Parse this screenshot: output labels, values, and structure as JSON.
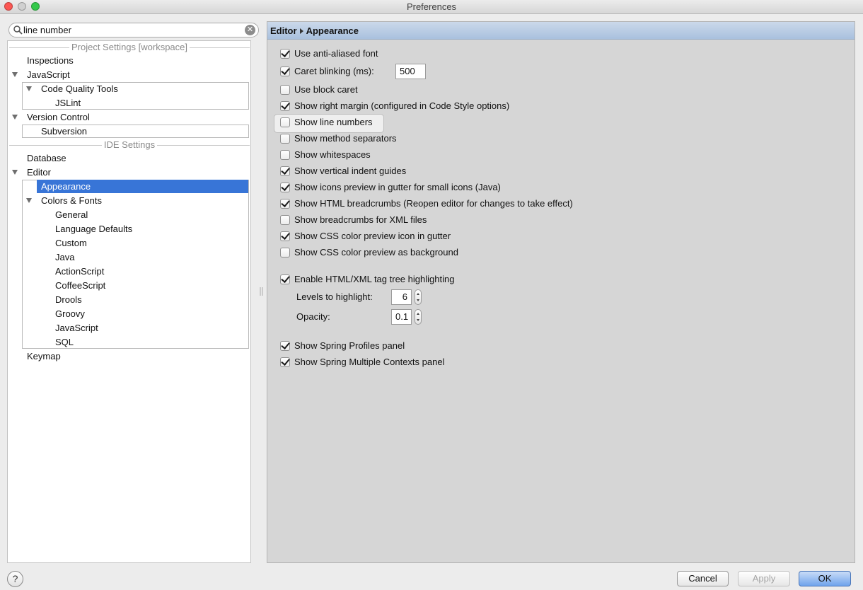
{
  "window": {
    "title": "Preferences"
  },
  "search": {
    "value": "line number"
  },
  "tree": {
    "project_header": "Project Settings [workspace]",
    "ide_header": "IDE Settings",
    "items": {
      "inspections": "Inspections",
      "javascript": "JavaScript",
      "code_quality_tools": "Code Quality Tools",
      "jslint": "JSLint",
      "version_control": "Version Control",
      "subversion": "Subversion",
      "database": "Database",
      "editor": "Editor",
      "appearance": "Appearance",
      "colors_fonts": "Colors & Fonts",
      "general": "General",
      "language_defaults": "Language Defaults",
      "custom": "Custom",
      "java": "Java",
      "actionscript": "ActionScript",
      "coffeescript": "CoffeeScript",
      "drools": "Drools",
      "groovy": "Groovy",
      "javascript2": "JavaScript",
      "sql": "SQL",
      "keymap": "Keymap"
    },
    "selected": "Appearance"
  },
  "panel": {
    "breadcrumb": [
      "Editor",
      "Appearance"
    ],
    "options": {
      "anti_aliased": {
        "label": "Use anti-aliased font",
        "checked": true
      },
      "caret_blinking": {
        "label": "Caret blinking (ms):",
        "checked": true,
        "value": "500"
      },
      "block_caret": {
        "label": "Use block caret",
        "checked": false
      },
      "right_margin": {
        "label": "Show right margin (configured in Code Style options)",
        "checked": true
      },
      "line_numbers": {
        "label": "Show line numbers",
        "checked": false
      },
      "method_separators": {
        "label": "Show method separators",
        "checked": false
      },
      "whitespaces": {
        "label": "Show whitespaces",
        "checked": false
      },
      "indent_guides": {
        "label": "Show vertical indent guides",
        "checked": true
      },
      "icons_preview": {
        "label": "Show icons preview in gutter for small icons (Java)",
        "checked": true
      },
      "html_breadcrumbs": {
        "label": "Show HTML breadcrumbs (Reopen editor for changes to take effect)",
        "checked": true
      },
      "xml_breadcrumbs": {
        "label": "Show breadcrumbs for XML files",
        "checked": false
      },
      "css_color_icon": {
        "label": "Show CSS color preview icon in gutter",
        "checked": true
      },
      "css_color_bg": {
        "label": "Show CSS color preview as background",
        "checked": false
      },
      "tag_tree": {
        "label": "Enable HTML/XML tag tree highlighting",
        "checked": true
      },
      "spring_profiles": {
        "label": "Show Spring Profiles panel",
        "checked": true
      },
      "spring_contexts": {
        "label": "Show Spring Multiple Contexts panel",
        "checked": true
      }
    },
    "levels": {
      "label": "Levels to highlight:",
      "value": "6"
    },
    "opacity": {
      "label": "Opacity:",
      "value": "0.1"
    }
  },
  "buttons": {
    "help": "?",
    "cancel": "Cancel",
    "apply": "Apply",
    "ok": "OK"
  },
  "colors": {
    "selection": "#3875d7",
    "header": "#b6cbe4",
    "panel_bg": "#d6d6d6"
  }
}
